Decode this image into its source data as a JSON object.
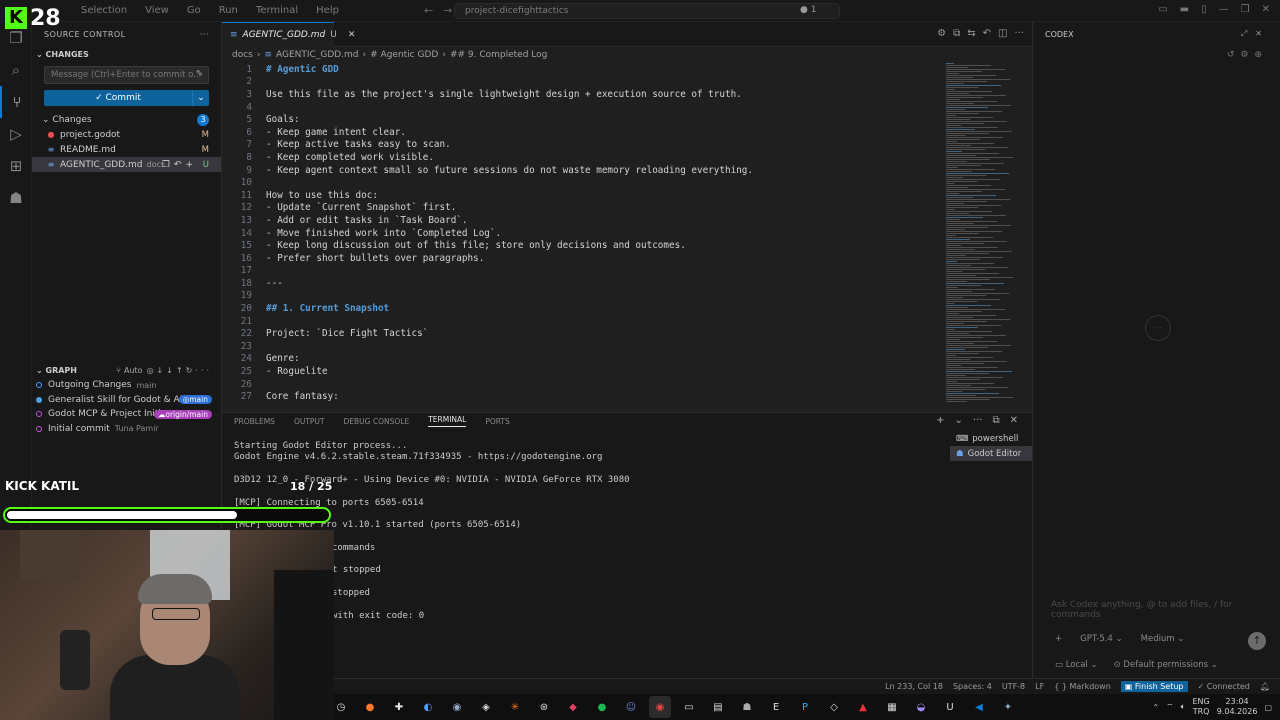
{
  "overlay": {
    "logo_letter": "K",
    "count": "28",
    "kick_title": "KICK KATIL",
    "goal_text": "18 / 25",
    "goal_fraction": 0.72
  },
  "titlebar": {
    "menu": [
      "Selection",
      "View",
      "Go",
      "Run",
      "Terminal",
      "Help"
    ],
    "search": "project-dicefighttactics",
    "notifications": "1"
  },
  "sidebar": {
    "title": "SOURCE CONTROL",
    "changes_section": "CHANGES",
    "message_placeholder": "Message (Ctrl+Enter to commit o...",
    "commit_label": "Commit",
    "changes_label": "Changes",
    "changes_count": "3",
    "files": [
      {
        "name": "project.godot",
        "status": "M",
        "extra": ""
      },
      {
        "name": "README.md",
        "status": "M",
        "extra": ""
      },
      {
        "name": "AGENTIC_GDD.md",
        "status": "U",
        "extra": "docs"
      }
    ],
    "graph_title": "GRAPH",
    "graph_auto": "Auto",
    "graph": [
      {
        "label": "Outgoing Changes",
        "meta": "main",
        "tag": ""
      },
      {
        "label": "Generalist Skill for Godot & AI ...",
        "meta": "",
        "tag": "main"
      },
      {
        "label": "Godot MCP & Project Initi...",
        "meta": "",
        "tag": "origin/main"
      },
      {
        "label": "Initial commit",
        "meta": "Tuna Pamir",
        "tag": ""
      }
    ]
  },
  "editor": {
    "tab_name": "AGENTIC_GDD.md",
    "tab_status": "U",
    "breadcrumb": [
      "docs",
      "AGENTIC_GDD.md",
      "# Agentic GDD",
      "## 9. Completed Log"
    ],
    "lines": [
      {
        "n": "1",
        "t": "# Agentic GDD",
        "k": "h"
      },
      {
        "n": "2",
        "t": "",
        "k": ""
      },
      {
        "n": "3",
        "t": "Use this file as the project's single lightweight design + execution source of truth.",
        "k": ""
      },
      {
        "n": "4",
        "t": "",
        "k": ""
      },
      {
        "n": "5",
        "t": "Goals:",
        "k": ""
      },
      {
        "n": "6",
        "t": "- Keep game intent clear.",
        "k": ""
      },
      {
        "n": "7",
        "t": "- Keep active tasks easy to scan.",
        "k": ""
      },
      {
        "n": "8",
        "t": "- Keep completed work visible.",
        "k": ""
      },
      {
        "n": "9",
        "t": "- Keep agent context small so future sessions do not waste memory reloading everything.",
        "k": ""
      },
      {
        "n": "10",
        "t": "",
        "k": ""
      },
      {
        "n": "11",
        "t": "How to use this doc:",
        "k": ""
      },
      {
        "n": "12",
        "t": "- Update `Current Snapshot` first.",
        "k": ""
      },
      {
        "n": "13",
        "t": "- Add or edit tasks in `Task Board`.",
        "k": ""
      },
      {
        "n": "14",
        "t": "- Move finished work into `Completed Log`.",
        "k": ""
      },
      {
        "n": "15",
        "t": "- Keep long discussion out of this file; store only decisions and outcomes.",
        "k": ""
      },
      {
        "n": "16",
        "t": "- Prefer short bullets over paragraphs.",
        "k": ""
      },
      {
        "n": "17",
        "t": "",
        "k": ""
      },
      {
        "n": "18",
        "t": "---",
        "k": ""
      },
      {
        "n": "19",
        "t": "",
        "k": ""
      },
      {
        "n": "20",
        "t": "## 1. Current Snapshot",
        "k": "h"
      },
      {
        "n": "21",
        "t": "",
        "k": ""
      },
      {
        "n": "22",
        "t": "Project: `Dice Fight Tactics`",
        "k": ""
      },
      {
        "n": "23",
        "t": "",
        "k": ""
      },
      {
        "n": "24",
        "t": "Genre:",
        "k": ""
      },
      {
        "n": "25",
        "t": "- Roguelite",
        "k": ""
      },
      {
        "n": "26",
        "t": "",
        "k": ""
      },
      {
        "n": "27",
        "t": "Core fantasy:",
        "k": ""
      }
    ]
  },
  "panel": {
    "tabs": [
      "PROBLEMS",
      "OUTPUT",
      "DEBUG CONSOLE",
      "TERMINAL",
      "PORTS"
    ],
    "active_tab": "TERMINAL",
    "terminal_lines": [
      "Starting Godot Editor process...",
      "Godot Engine v4.6.2.stable.steam.71f334935 - https://godotengine.org",
      "",
      "D3D12 12_0 - Forward+ - Using Device #0: NVIDIA - NVIDIA GeForce RTX 3080",
      "",
      "[MCP] Connecting to ports 6505-6514",
      "",
      "[MCP] Godot MCP Pro v1.10.1 started (ports 6505-6514)",
      "",
      "commands",
      "",
      "t stopped",
      "",
      "stopped",
      "",
      "with exit code: 0"
    ],
    "terminals": [
      "powershell",
      "Godot Editor"
    ]
  },
  "codex": {
    "title": "CODEX",
    "placeholder": "Ask Codex anything, @ to add files, / for commands",
    "model": "GPT-5.4",
    "effort": "Medium",
    "local": "Local",
    "permissions": "Default permissions"
  },
  "statusbar": {
    "position": "Ln 233, Col 18",
    "spaces": "Spaces: 4",
    "encoding": "UTF-8",
    "eol": "LF",
    "language": "Markdown",
    "finish": "Finish Setup",
    "connection": "Connected"
  },
  "taskbar": {
    "lang": "ENG",
    "region": "TRQ",
    "time": "23:04",
    "date": "9.04.2026"
  }
}
